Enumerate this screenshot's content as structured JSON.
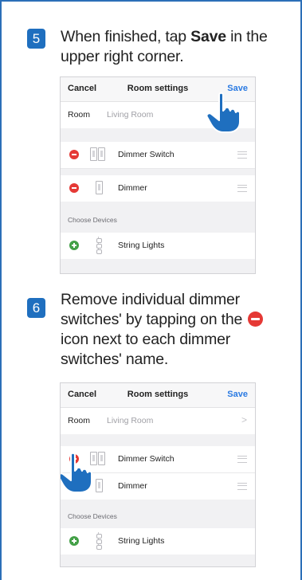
{
  "steps": [
    {
      "number": "5",
      "text_before": "When finished, tap ",
      "text_bold": "Save",
      "text_after": " in the upper right corner."
    },
    {
      "number": "6",
      "text_before": "Remove individual dimmer switches' by tapping on the ",
      "text_after": " icon next to each dimmer switches' name."
    }
  ],
  "screen": {
    "nav": {
      "cancel": "Cancel",
      "title": "Room settings",
      "save": "Save"
    },
    "room": {
      "label": "Room",
      "value": "Living Room",
      "chevron": ">"
    },
    "devices": [
      {
        "name": "Dimmer Switch",
        "icon": "dimmer-switch-icon"
      },
      {
        "name": "Dimmer",
        "icon": "dimmer-icon"
      }
    ],
    "choose_label": "Choose Devices",
    "available": [
      {
        "name": "String Lights",
        "icon": "string-lights-icon"
      }
    ]
  },
  "colors": {
    "accent_blue": "#1f6fbf",
    "save_blue": "#2a7ae2",
    "remove_red": "#e53935",
    "add_green": "#43a047"
  }
}
